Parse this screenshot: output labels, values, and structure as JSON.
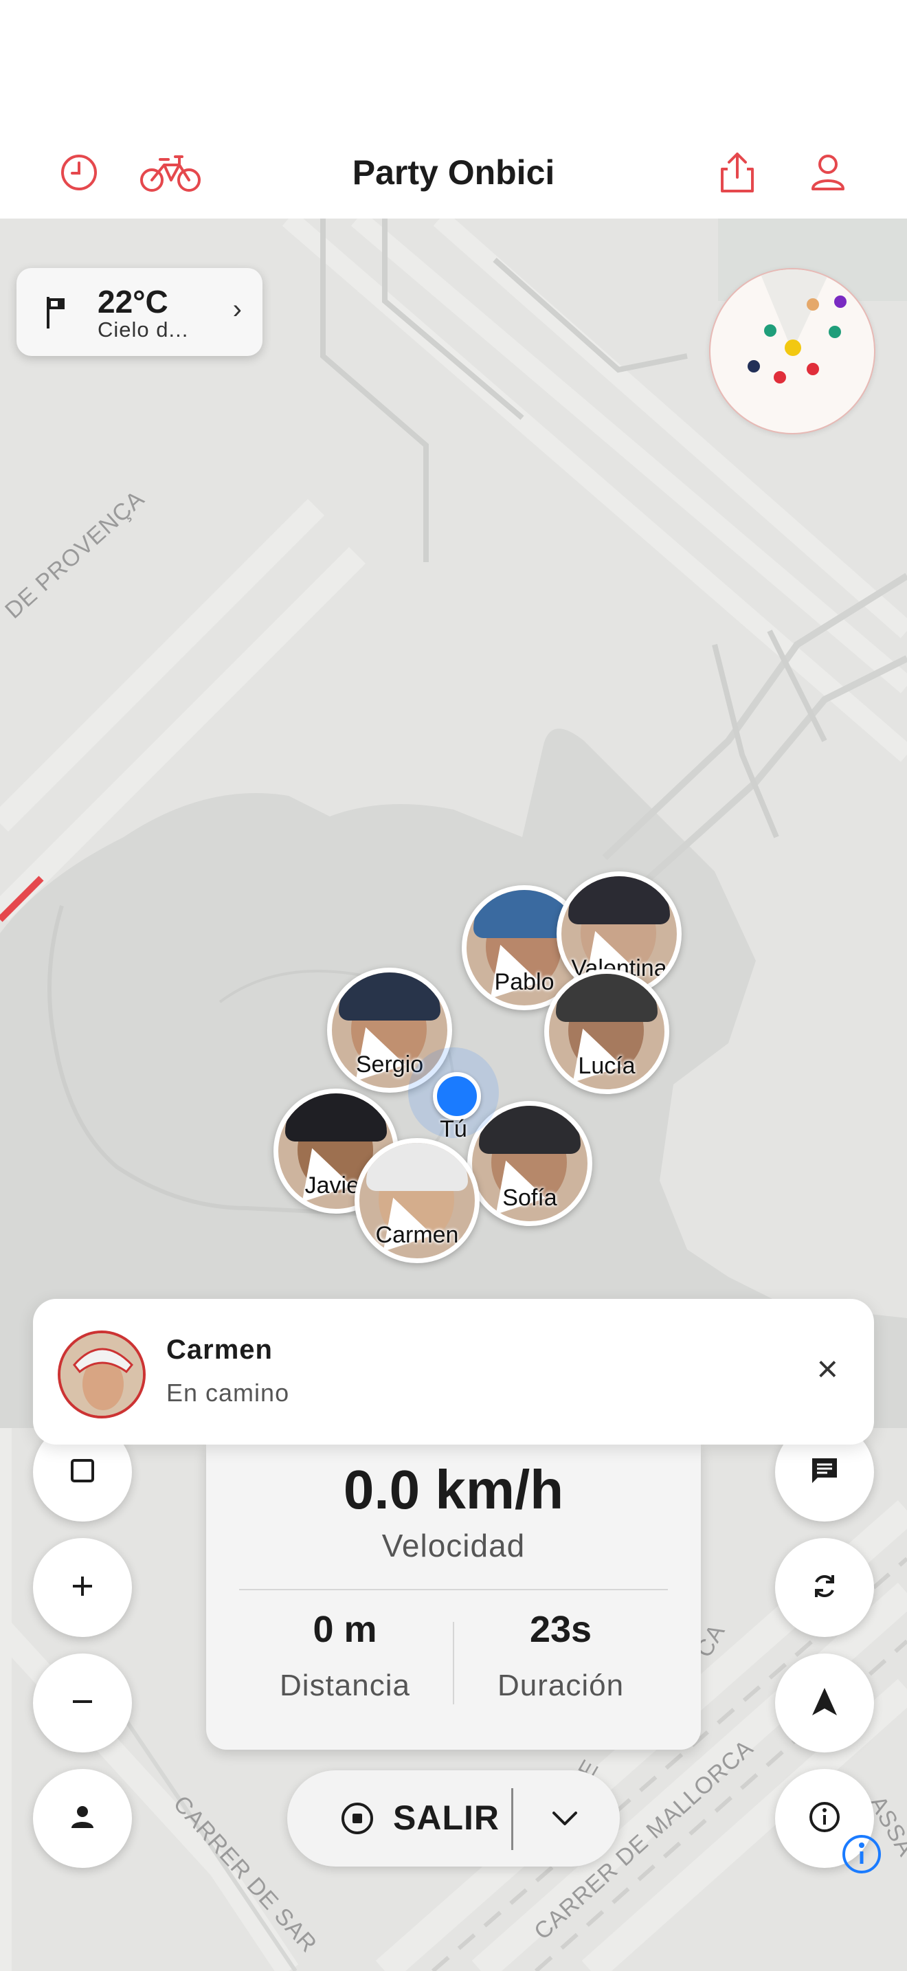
{
  "header": {
    "title": "Party Onbici",
    "left_icons": [
      "clock-icon",
      "bicycle-icon"
    ],
    "right_icons": [
      "share-icon",
      "profile-icon"
    ],
    "accent_color": "#e5484d"
  },
  "weather": {
    "temperature": "22°C",
    "description": "Cielo d..."
  },
  "map": {
    "streets": [
      "DE PROVENÇA",
      "CARRER DE MALLORCA",
      "CARRER DE SAR",
      "CARRE",
      "CA",
      "ASSA"
    ],
    "me_label": "Tú",
    "riders": [
      {
        "name": "Pablo"
      },
      {
        "name": "Valentina"
      },
      {
        "name": "Lucía"
      },
      {
        "name": "Sergio"
      },
      {
        "name": "Javier"
      },
      {
        "name": "Carmen"
      },
      {
        "name": "Sofía"
      }
    ]
  },
  "notification": {
    "name": "Carmen",
    "status": "En camino"
  },
  "stats": {
    "speed": "0.0 km/h",
    "speed_label": "Velocidad",
    "distance": "0 m",
    "distance_label": "Distancia",
    "duration": "23s",
    "duration_label": "Duración"
  },
  "controls": {
    "exit_label": "SALIR",
    "left_buttons": [
      "square-icon",
      "plus-icon",
      "minus-icon",
      "person-icon"
    ],
    "right_buttons": [
      "chat-icon",
      "refresh-icon",
      "navigation-arrow-icon",
      "info-icon"
    ]
  }
}
